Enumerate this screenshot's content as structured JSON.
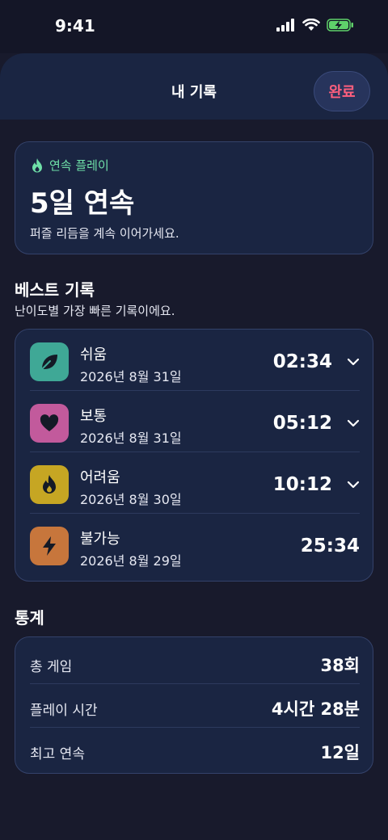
{
  "status": {
    "time": "9:41"
  },
  "nav": {
    "title": "내 기록",
    "done_label": "완료"
  },
  "streak": {
    "label": "연속 플레이",
    "value": "5일 연속",
    "description": "퍼즐 리듬을 계속 이어가세요."
  },
  "best": {
    "title": "베스트 기록",
    "subtitle": "난이도별 가장 빠른 기록이에요.",
    "items": [
      {
        "name": "쉬움",
        "date": "2026년 8월 31일",
        "time": "02:34",
        "icon": "leaf-icon",
        "color": "#3fa896",
        "expandable": true
      },
      {
        "name": "보통",
        "date": "2026년 8월 31일",
        "time": "05:12",
        "icon": "heart-icon",
        "color": "#c25a9c",
        "expandable": true
      },
      {
        "name": "어려움",
        "date": "2026년 8월 30일",
        "time": "10:12",
        "icon": "flame-icon",
        "color": "#c6a623",
        "expandable": true
      },
      {
        "name": "불가능",
        "date": "2026년 8월 29일",
        "time": "25:34",
        "icon": "bolt-icon",
        "color": "#c7763c",
        "expandable": false
      }
    ]
  },
  "stats": {
    "title": "통계",
    "items": [
      {
        "label": "총 게임",
        "value": "38회"
      },
      {
        "label": "플레이 시간",
        "value": "4시간 28분"
      },
      {
        "label": "최고 연속",
        "value": "12일"
      }
    ]
  },
  "colors": {
    "accent_green": "#6fe0a8",
    "done_pink": "#ff5f7e",
    "card_bg": "#1a2542",
    "page_bg": "#181a2c"
  }
}
